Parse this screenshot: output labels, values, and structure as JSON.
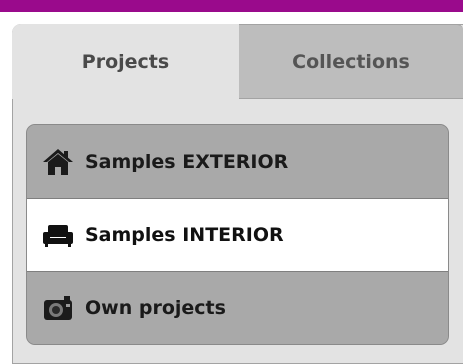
{
  "colors": {
    "accent_bar": "#9a0a8c",
    "selected_row": "#ffffff",
    "row_bg": "#a9a9a9"
  },
  "tabs": [
    {
      "label": "Projects",
      "active": true
    },
    {
      "label": "Collections",
      "active": false
    }
  ],
  "items": [
    {
      "label": "Samples EXTERIOR",
      "icon": "house-icon",
      "selected": false
    },
    {
      "label": "Samples INTERIOR",
      "icon": "sofa-icon",
      "selected": true
    },
    {
      "label": "Own projects",
      "icon": "camera-icon",
      "selected": false
    }
  ]
}
